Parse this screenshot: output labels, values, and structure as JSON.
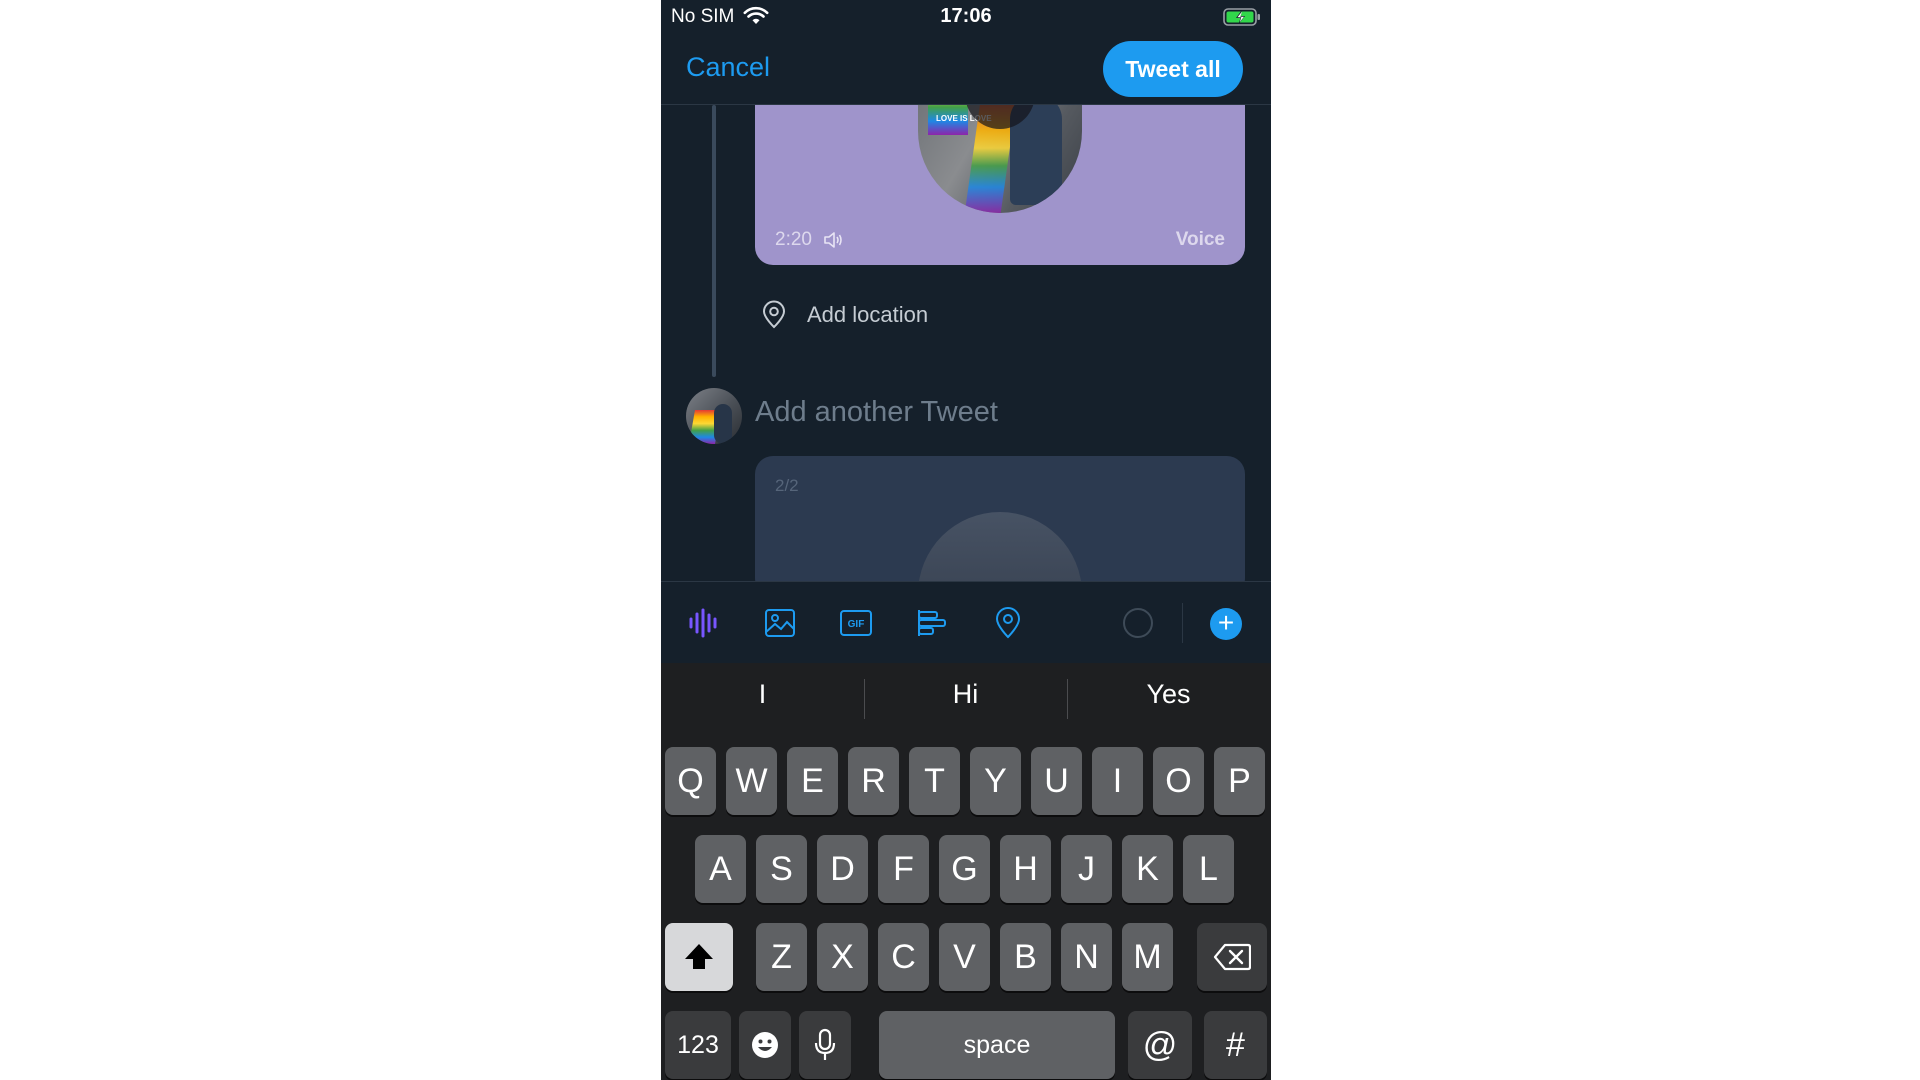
{
  "status_bar": {
    "carrier": "No SIM",
    "time": "17:06"
  },
  "header": {
    "cancel_label": "Cancel",
    "tweet_all_label": "Tweet all"
  },
  "voice_card": {
    "duration": "2:20",
    "label": "Voice",
    "art_text": "LOVE IS LOVE"
  },
  "location": {
    "label": "Add location"
  },
  "next_tweet": {
    "placeholder": "Add another Tweet",
    "page_indicator": "2/2"
  },
  "toolbar": {
    "icons": [
      "voice-icon",
      "image-icon",
      "gif-icon",
      "poll-icon",
      "location-icon",
      "character-count-ring",
      "add-tweet-icon"
    ],
    "accent_color": "#1d9bf0",
    "voice_color": "#7856ff"
  },
  "keyboard": {
    "suggestions": [
      "I",
      "Hi",
      "Yes"
    ],
    "row1": [
      "Q",
      "W",
      "E",
      "R",
      "T",
      "Y",
      "U",
      "I",
      "O",
      "P"
    ],
    "row2": [
      "A",
      "S",
      "D",
      "F",
      "G",
      "H",
      "J",
      "K",
      "L"
    ],
    "row3": [
      "Z",
      "X",
      "C",
      "V",
      "B",
      "N",
      "M"
    ],
    "numbers_label": "123",
    "space_label": "space",
    "at_label": "@",
    "hash_label": "#"
  }
}
